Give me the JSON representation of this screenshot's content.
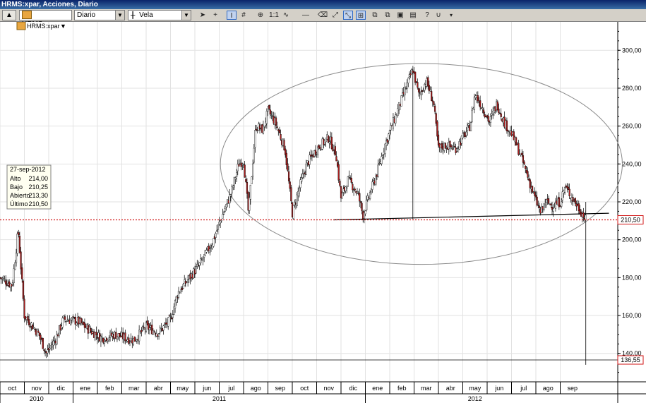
{
  "window": {
    "title": "HRMS:xpar, Acciones, Diario"
  },
  "toolbar": {
    "symbol": "HRMS:xpar",
    "period": "Diario",
    "style": "Vela",
    "scale": "1:1"
  },
  "legend": {
    "symbol": "HRMS:xpar"
  },
  "info": {
    "date": "27-sep-2012",
    "rows": [
      {
        "label": "Alto",
        "value": "214,00"
      },
      {
        "label": "Bajo",
        "value": "210,25"
      },
      {
        "label": "Abierto",
        "value": "213,30"
      },
      {
        "label": "Último",
        "value": "210,50"
      }
    ]
  },
  "price_tags": {
    "last": "210,50",
    "target": "136,55"
  },
  "colors": {
    "up": "#ffffff",
    "down": "#aa1e1e",
    "wick": "#000000",
    "last_line": "#d01414",
    "tag_border": "#d01414"
  },
  "chart_data": {
    "type": "candlestick",
    "ylim": [
      125,
      315
    ],
    "yticks": [
      140,
      160,
      180,
      200,
      220,
      240,
      260,
      280,
      300
    ],
    "ytick_labels": [
      "140,00",
      "160,00",
      "180,00",
      "200,00",
      "220,00",
      "240,00",
      "260,00",
      "280,00",
      "300,00"
    ],
    "months": [
      "oct",
      "nov",
      "dic",
      "ene",
      "feb",
      "mar",
      "abr",
      "may",
      "jun",
      "jul",
      "ago",
      "sep",
      "oct",
      "nov",
      "dic",
      "ene",
      "feb",
      "mar",
      "abr",
      "may",
      "jun",
      "jul",
      "ago",
      "sep"
    ],
    "years": [
      {
        "label": "2010",
        "start": 0,
        "end": 3
      },
      {
        "label": "2011",
        "start": 3,
        "end": 15
      },
      {
        "label": "2012",
        "start": 15,
        "end": 24
      }
    ],
    "close_path": [
      {
        "x": 0,
        "y": 180
      },
      {
        "x": 0.5,
        "y": 176
      },
      {
        "x": 0.75,
        "y": 205
      },
      {
        "x": 1,
        "y": 160
      },
      {
        "x": 1.6,
        "y": 150
      },
      {
        "x": 1.9,
        "y": 140
      },
      {
        "x": 2.3,
        "y": 148
      },
      {
        "x": 2.6,
        "y": 158
      },
      {
        "x": 3.2,
        "y": 157
      },
      {
        "x": 3.7,
        "y": 152
      },
      {
        "x": 4.2,
        "y": 148
      },
      {
        "x": 4.7,
        "y": 150
      },
      {
        "x": 5.2,
        "y": 148
      },
      {
        "x": 5.5,
        "y": 147
      },
      {
        "x": 6,
        "y": 154
      },
      {
        "x": 6.5,
        "y": 151
      },
      {
        "x": 6.8,
        "y": 155
      },
      {
        "x": 7,
        "y": 158
      },
      {
        "x": 7.3,
        "y": 172
      },
      {
        "x": 7.6,
        "y": 177
      },
      {
        "x": 8.2,
        "y": 187
      },
      {
        "x": 8.7,
        "y": 198
      },
      {
        "x": 9.1,
        "y": 212
      },
      {
        "x": 9.5,
        "y": 225
      },
      {
        "x": 9.8,
        "y": 240
      },
      {
        "x": 10.0,
        "y": 242
      },
      {
        "x": 10.2,
        "y": 214
      },
      {
        "x": 10.5,
        "y": 260
      },
      {
        "x": 10.8,
        "y": 258
      },
      {
        "x": 11.0,
        "y": 268
      },
      {
        "x": 11.3,
        "y": 262
      },
      {
        "x": 11.7,
        "y": 248
      },
      {
        "x": 12.0,
        "y": 214
      },
      {
        "x": 12.3,
        "y": 228
      },
      {
        "x": 12.6,
        "y": 240
      },
      {
        "x": 13.0,
        "y": 248
      },
      {
        "x": 13.5,
        "y": 254
      },
      {
        "x": 13.8,
        "y": 245
      },
      {
        "x": 14.0,
        "y": 222
      },
      {
        "x": 14.3,
        "y": 232
      },
      {
        "x": 14.7,
        "y": 224
      },
      {
        "x": 14.9,
        "y": 213
      },
      {
        "x": 15.2,
        "y": 225
      },
      {
        "x": 15.5,
        "y": 236
      },
      {
        "x": 15.8,
        "y": 250
      },
      {
        "x": 16.2,
        "y": 264
      },
      {
        "x": 16.6,
        "y": 278
      },
      {
        "x": 16.95,
        "y": 290
      },
      {
        "x": 17.2,
        "y": 276
      },
      {
        "x": 17.5,
        "y": 284
      },
      {
        "x": 17.8,
        "y": 272
      },
      {
        "x": 18.0,
        "y": 248
      },
      {
        "x": 18.3,
        "y": 250
      },
      {
        "x": 18.7,
        "y": 248
      },
      {
        "x": 19.0,
        "y": 254
      },
      {
        "x": 19.3,
        "y": 260
      },
      {
        "x": 19.5,
        "y": 277
      },
      {
        "x": 19.8,
        "y": 270
      },
      {
        "x": 20.1,
        "y": 262
      },
      {
        "x": 20.4,
        "y": 272
      },
      {
        "x": 20.7,
        "y": 262
      },
      {
        "x": 21.0,
        "y": 256
      },
      {
        "x": 21.3,
        "y": 247
      },
      {
        "x": 21.6,
        "y": 236
      },
      {
        "x": 21.9,
        "y": 224
      },
      {
        "x": 22.2,
        "y": 214
      },
      {
        "x": 22.4,
        "y": 220
      },
      {
        "x": 22.7,
        "y": 218
      },
      {
        "x": 23.0,
        "y": 220
      },
      {
        "x": 23.2,
        "y": 228
      },
      {
        "x": 23.5,
        "y": 222
      },
      {
        "x": 23.8,
        "y": 216
      },
      {
        "x": 24.05,
        "y": 210.5
      }
    ],
    "annotations": {
      "ellipse": {
        "cx": 17.3,
        "cy": 240,
        "rx_months": 8.25,
        "ry_value": 53
      },
      "neckline": [
        {
          "x": 13.7,
          "y": 210.5
        },
        {
          "x": 25.0,
          "y": 214
        }
      ],
      "head_line": [
        {
          "x": 16.95,
          "y": 290
        },
        {
          "x": 16.95,
          "y": 211
        }
      ],
      "target_line": [
        {
          "x": 24.05,
          "y": 220
        },
        {
          "x": 24.05,
          "y": 134
        }
      ],
      "last_level": 210.5,
      "target_level": 136.55
    }
  }
}
